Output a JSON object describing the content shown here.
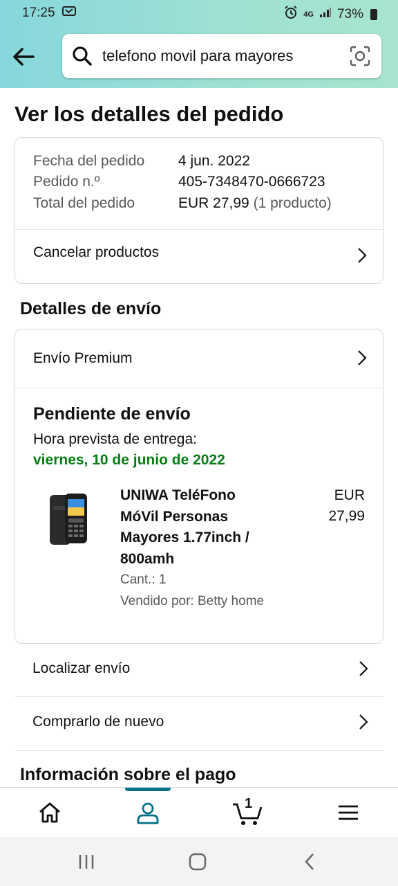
{
  "status_bar": {
    "time": "17:25",
    "network": "4G",
    "battery": "73%"
  },
  "search": {
    "value": "telefono movil para mayores",
    "placeholder": ""
  },
  "page": {
    "title": "Ver los detalles del pedido"
  },
  "order_summary": {
    "rows": [
      {
        "label": "Fecha del pedido",
        "value": "4 jun. 2022"
      },
      {
        "label": "Pedido n.º",
        "value": "405-7348470-0666723"
      },
      {
        "label": "Total del pedido",
        "value": "EUR 27,99",
        "extra": "(1 producto)"
      }
    ],
    "cancel_label": "Cancelar productos"
  },
  "shipping": {
    "section_title": "Detalles de envío",
    "method": "Envío Premium",
    "status": "Pendiente de envío",
    "eta_label": "Hora prevista de entrega:",
    "eta_date": "viernes, 10 de junio de 2022",
    "product": {
      "title": "UNIWA TeléFono MóVil Personas Mayores 1.77inch / 800amh",
      "price_currency": "EUR",
      "price_amount": "27,99",
      "quantity": "Cant.: 1",
      "seller": "Vendido por: Betty home"
    },
    "track_label": "Localizar envío",
    "buy_again_label": "Comprarlo de nuevo"
  },
  "payment": {
    "section_title": "Información sobre el pago"
  },
  "bottom_nav": {
    "cart_count": "1",
    "active_color": "#007185"
  },
  "colors": {
    "eta_green": "#067d14",
    "accent_teal": "#007185"
  }
}
